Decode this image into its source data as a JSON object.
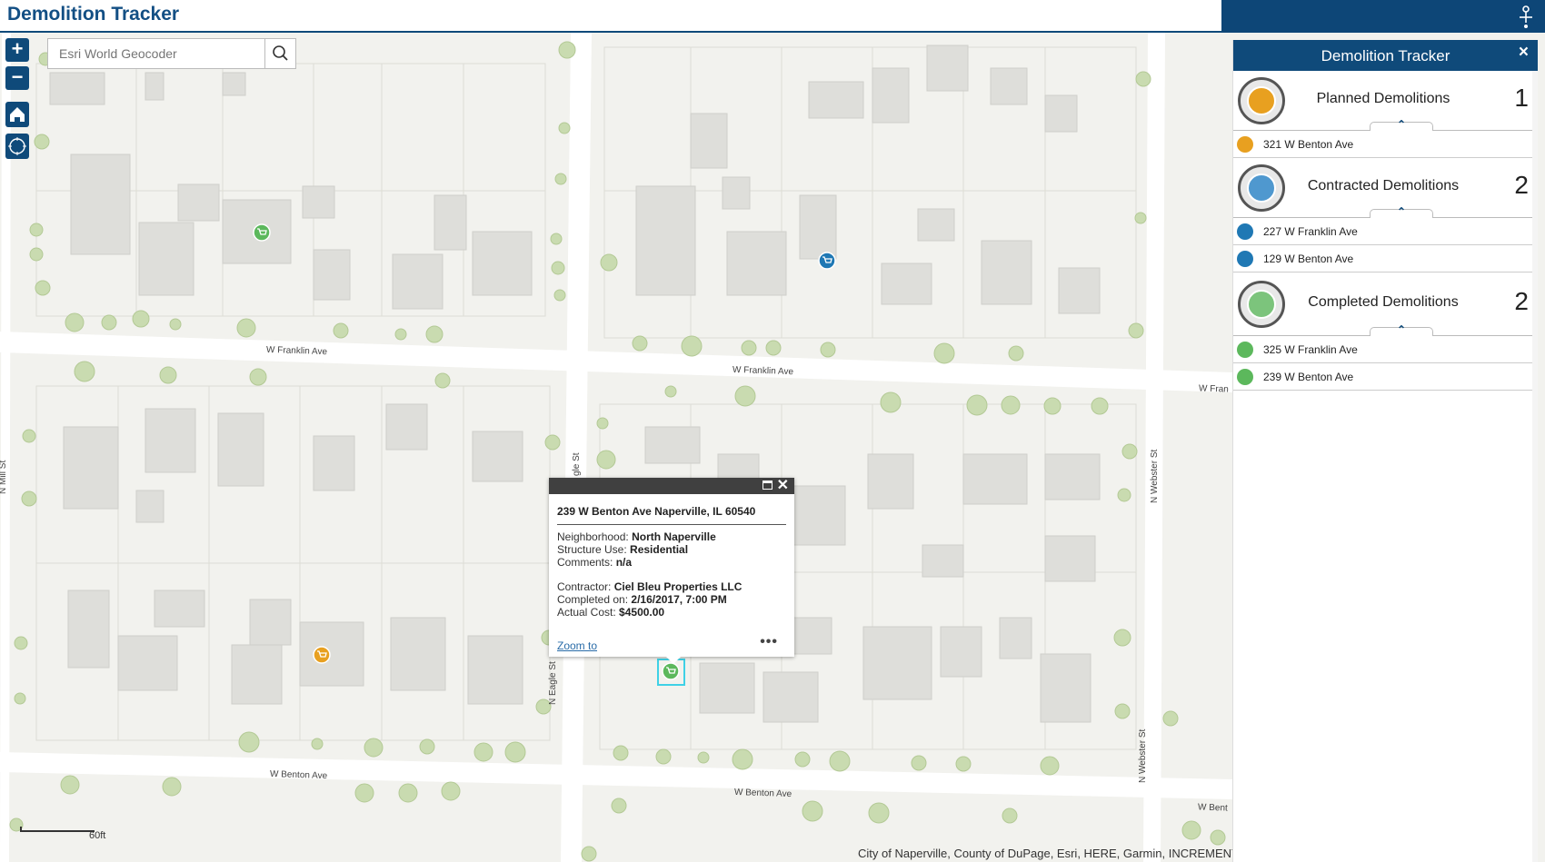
{
  "header": {
    "title": "Demolition Tracker",
    "icon": "network-icon"
  },
  "map": {
    "search_placeholder": "Esri World Geocoder",
    "zoom_in": "+",
    "zoom_out": "−",
    "scale_label": "60ft",
    "attribution": "City of Naperville, County of DuPage, Esri, HERE, Garmin, INCREMENT",
    "streets": {
      "w_franklin_1": "W Franklin Ave",
      "w_franklin_2": "W Franklin Ave",
      "w_franklin_3": "W Fran",
      "w_benton_1": "W Benton Ave",
      "w_benton_2": "W Benton Ave",
      "w_benton_3": "W Bent",
      "n_eagle_1": "N Eagle St",
      "n_eagle_2": "gle St",
      "n_webster_1": "N Webster St",
      "n_webster_2": "N Webster St",
      "n_mill": "N Mill St"
    },
    "colors": {
      "planned": "#e8a020",
      "contracted": "#1f78b4",
      "completed": "#5cb85c"
    }
  },
  "popup": {
    "title": "239 W Benton Ave Naperville, IL 60540",
    "neighborhood_label": "Neighborhood:",
    "neighborhood": "North Naperville",
    "structure_label": "Structure Use:",
    "structure": "Residential",
    "comments_label": "Comments:",
    "comments": "n/a",
    "contractor_label": "Contractor:",
    "contractor": "Ciel Bleu Properties LLC",
    "completed_label": "Completed on:",
    "completed": "2/16/2017, 7:00 PM",
    "cost_label": "Actual Cost:",
    "cost": "$4500.00",
    "zoom_link": "Zoom to",
    "more": "•••"
  },
  "panel": {
    "title": "Demolition Tracker",
    "close": "×",
    "categories": [
      {
        "label": "Planned Demolitions",
        "count": "1",
        "items": [
          "321 W Benton Ave"
        ]
      },
      {
        "label": "Contracted Demolitions",
        "count": "2",
        "items": [
          "227 W Franklin Ave",
          "129 W Benton Ave"
        ]
      },
      {
        "label": "Completed Demolitions",
        "count": "2",
        "items": [
          "325 W Franklin Ave",
          "239 W Benton Ave"
        ]
      }
    ]
  }
}
